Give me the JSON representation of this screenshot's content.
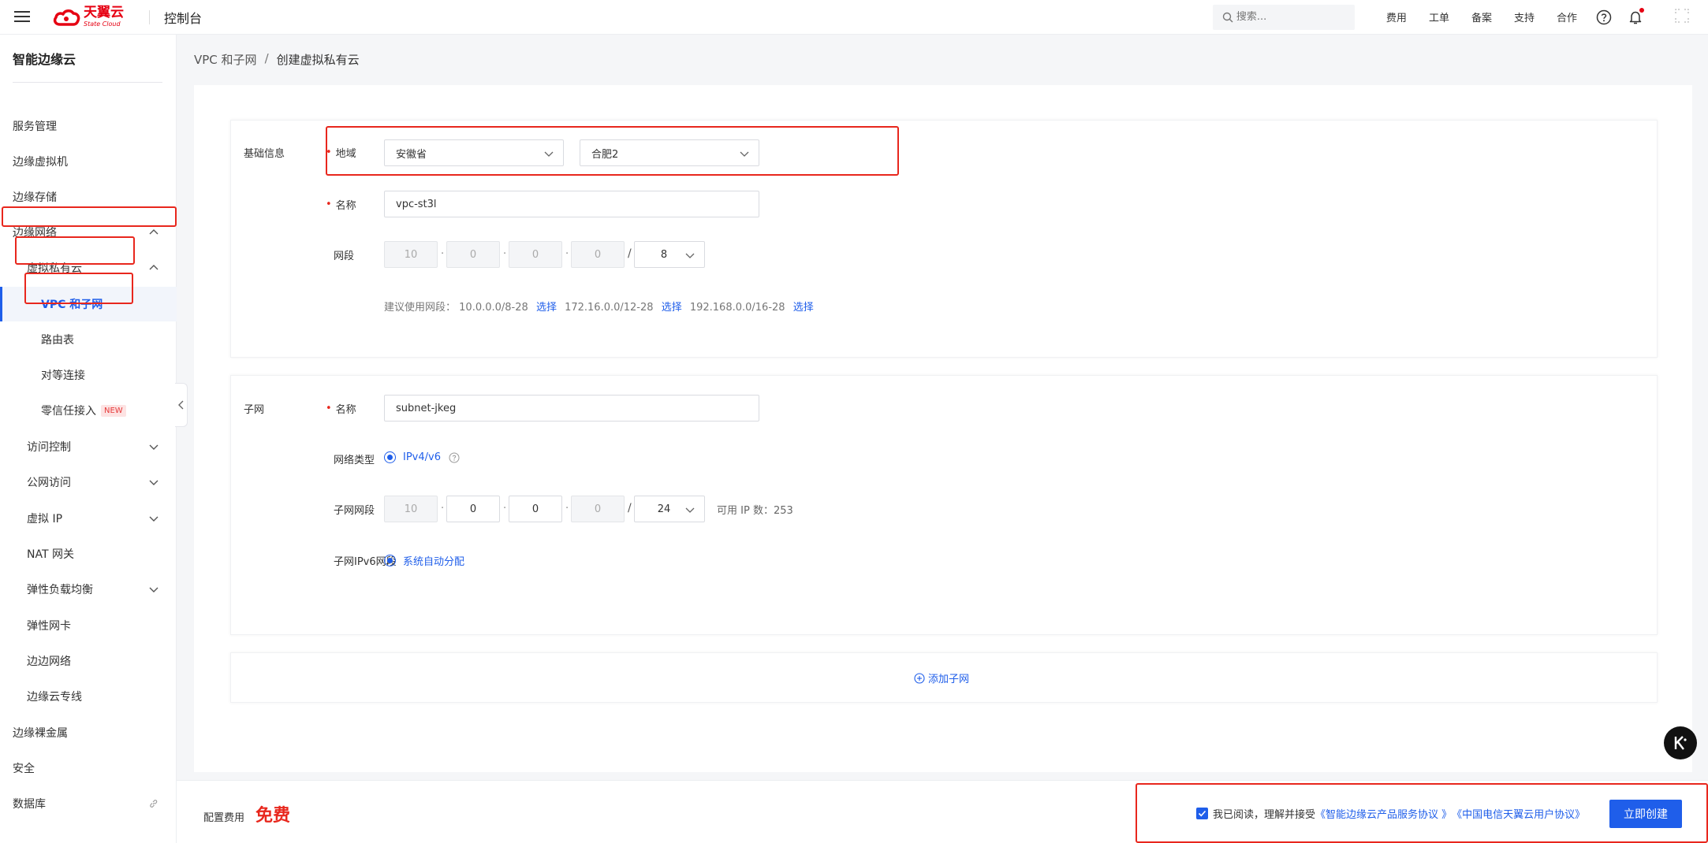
{
  "header": {
    "logo_cn": "天翼云",
    "logo_en": "State Cloud",
    "console": "控制台",
    "search_placeholder": "搜索...",
    "links": [
      "费用",
      "工单",
      "备案",
      "支持",
      "合作"
    ]
  },
  "sidebar": {
    "title": "智能边缘云",
    "items": [
      {
        "label": "服务管理"
      },
      {
        "label": "边缘虚拟机"
      },
      {
        "label": "边缘存储"
      },
      {
        "label": "边缘网络"
      },
      {
        "label": "虚拟私有云"
      },
      {
        "label": "VPC 和子网"
      },
      {
        "label": "路由表"
      },
      {
        "label": "对等连接"
      },
      {
        "label": "零信任接入",
        "badge": "NEW"
      },
      {
        "label": "访问控制"
      },
      {
        "label": "公网访问"
      },
      {
        "label": "虚拟 IP"
      },
      {
        "label": "NAT 网关"
      },
      {
        "label": "弹性负载均衡"
      },
      {
        "label": "弹性网卡"
      },
      {
        "label": "边边网络"
      },
      {
        "label": "边缘云专线"
      },
      {
        "label": "边缘裸金属"
      },
      {
        "label": "安全"
      },
      {
        "label": "数据库"
      }
    ]
  },
  "breadcrumb": {
    "parent": "VPC 和子网",
    "separator": "/",
    "current": "创建虚拟私有云"
  },
  "basic": {
    "section": "基础信息",
    "region_label": "地域",
    "province": "安徽省",
    "city": "合肥2",
    "name_label": "名称",
    "name_value": "vpc-st3l",
    "cidr_label": "网段",
    "cidr": [
      "10",
      "0",
      "0",
      "0"
    ],
    "mask": "8",
    "hint_prefix": "建议使用网段：",
    "suggestions": [
      {
        "range": "10.0.0.0/8-28",
        "action": "选择"
      },
      {
        "range": "172.16.0.0/12-28",
        "action": "选择"
      },
      {
        "range": "192.168.0.0/16-28",
        "action": "选择"
      }
    ]
  },
  "subnet": {
    "section": "子网",
    "name_label": "名称",
    "name_value": "subnet-jkeg",
    "type_label": "网络类型",
    "type_value": "IPv4/v6",
    "cidr_label": "子网网段",
    "cidr": [
      "10",
      "0",
      "0",
      "0"
    ],
    "mask": "24",
    "available_ip": "可用 IP 数：253",
    "ipv6_label": "子网IPv6网段",
    "ipv6_value": "系统自动分配"
  },
  "add_subnet": "添加子网",
  "footer": {
    "fee_label": "配置费用",
    "fee_value": "免费",
    "agree_text": "我已阅读，理解并接受",
    "agreement1": "《智能边缘云产品服务协议 》",
    "agreement2": "《中国电信天翼云用户协议》",
    "create": "立即创建"
  },
  "colors": {
    "primary": "#1f5eea",
    "highlight": "#e8271d",
    "brand": "#e60012"
  }
}
